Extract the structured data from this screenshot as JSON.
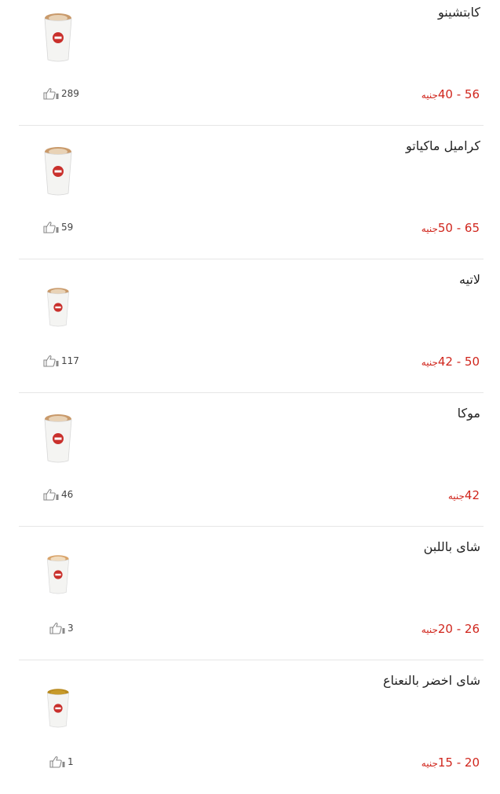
{
  "colors": {
    "price": "#d0261d",
    "divider": "#e6e6e6",
    "name": "#222222"
  },
  "icons": {
    "like": "thumbs-up-icon",
    "product": "coffee-cup-image"
  },
  "items": [
    {
      "name": "كابتشينو",
      "price": "40 - 56",
      "currency": "جنيه",
      "likes": "289"
    },
    {
      "name": "كراميل ماكياتو",
      "price": "50 - 65",
      "currency": "جنيه",
      "likes": "59"
    },
    {
      "name": "لاتيه",
      "price": "42 - 50",
      "currency": "جنيه",
      "likes": "117"
    },
    {
      "name": "موكا",
      "price": "42",
      "currency": "جنيه",
      "likes": "46"
    },
    {
      "name": "شاى باللبن",
      "price": "20 - 26",
      "currency": "جنيه",
      "likes": "3"
    },
    {
      "name": "شاى اخضر بالنعناع",
      "price": "15 - 20",
      "currency": "جنيه",
      "likes": "1"
    }
  ]
}
